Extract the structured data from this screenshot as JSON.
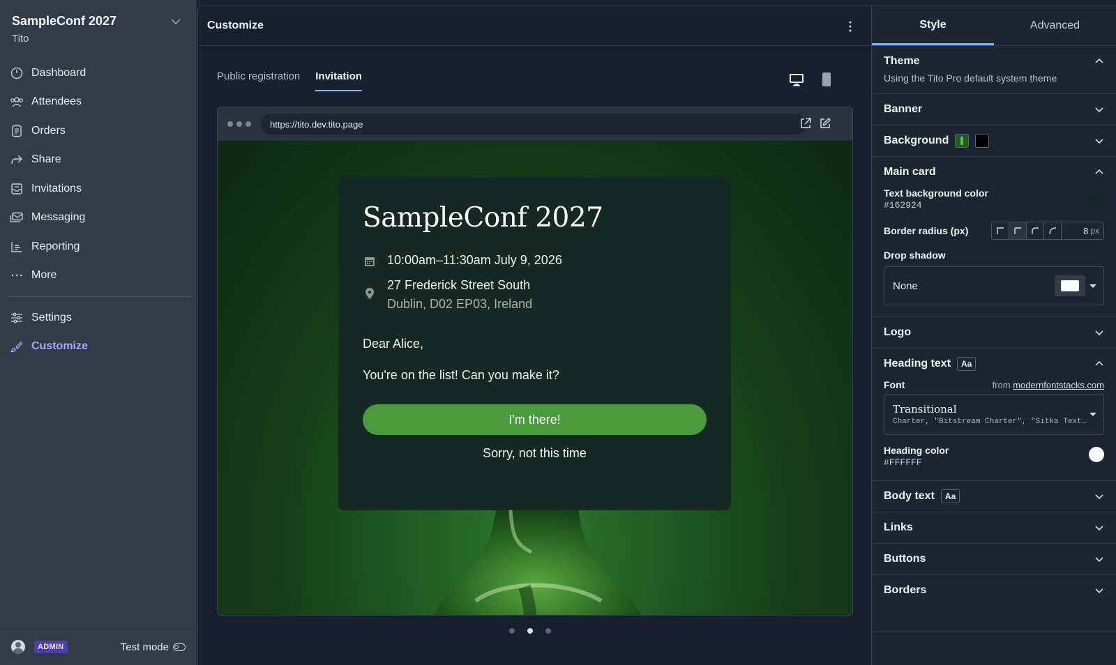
{
  "sidebar": {
    "org_name": "SampleConf 2027",
    "org_sub": "Tito",
    "items": [
      {
        "label": "Dashboard",
        "icon": "dashboard-icon"
      },
      {
        "label": "Attendees",
        "icon": "users-icon"
      },
      {
        "label": "Orders",
        "icon": "receipt-icon"
      },
      {
        "label": "Share",
        "icon": "share-icon"
      },
      {
        "label": "Invitations",
        "icon": "inbox-icon"
      },
      {
        "label": "Messaging",
        "icon": "mail-icon"
      },
      {
        "label": "Reporting",
        "icon": "chart-icon"
      },
      {
        "label": "More",
        "icon": "ellipsis-icon"
      }
    ],
    "bottom_items": [
      {
        "label": "Settings",
        "icon": "sliders-icon"
      },
      {
        "label": "Customize",
        "icon": "brush-icon",
        "active": true
      }
    ],
    "footer": {
      "badge": "ADMIN",
      "test_mode": "Test mode"
    }
  },
  "main": {
    "title": "Customize",
    "tabs": [
      {
        "label": "Public registration",
        "active": false
      },
      {
        "label": "Invitation",
        "active": true
      }
    ],
    "browser": {
      "url": "https://tito.dev.tito.page"
    },
    "card": {
      "title": "SampleConf 2027",
      "datetime": "10:00am–11:30am July 9, 2026",
      "address_line1": "27 Frederick Street South",
      "address_line2": "Dublin, D02 EP03, Ireland",
      "greeting": "Dear Alice,",
      "message": "You're on the list! Can you make it?",
      "accept": "I'm there!",
      "decline": "Sorry, not this time"
    },
    "pager": {
      "count": 3,
      "active": 2
    }
  },
  "panel": {
    "tabs": [
      {
        "label": "Style",
        "active": true
      },
      {
        "label": "Advanced",
        "active": false
      }
    ],
    "theme": {
      "title": "Theme",
      "desc": "Using the Tito Pro default system theme"
    },
    "banner": {
      "title": "Banner"
    },
    "background": {
      "title": "Background",
      "swatch_color": "#000000"
    },
    "main_card": {
      "title": "Main card",
      "text_bg_label": "Text background color",
      "text_bg_value": "#162924",
      "radius_label": "Border radius (px)",
      "radius_value": "8",
      "radius_unit": "px",
      "shadow_label": "Drop shadow",
      "shadow_value": "None"
    },
    "logo": {
      "title": "Logo"
    },
    "heading_text": {
      "title": "Heading text",
      "aa": "Aa",
      "font_label": "Font",
      "font_from": "from",
      "font_link": "modernfontstacks.com",
      "font_name": "Transitional",
      "font_stack": "Charter, \"Bitstream Charter\", \"Sitka Text\", Cambria, serif",
      "color_label": "Heading color",
      "color_value": "#FFFFFF"
    },
    "body_text": {
      "title": "Body text",
      "aa": "Aa"
    },
    "links": {
      "title": "Links"
    },
    "buttons": {
      "title": "Buttons"
    },
    "borders": {
      "title": "Borders"
    }
  },
  "colors": {
    "accent": "#b3a6ff",
    "button_green": "#4c9a3e",
    "tab_underline": "#8ab4ff"
  }
}
